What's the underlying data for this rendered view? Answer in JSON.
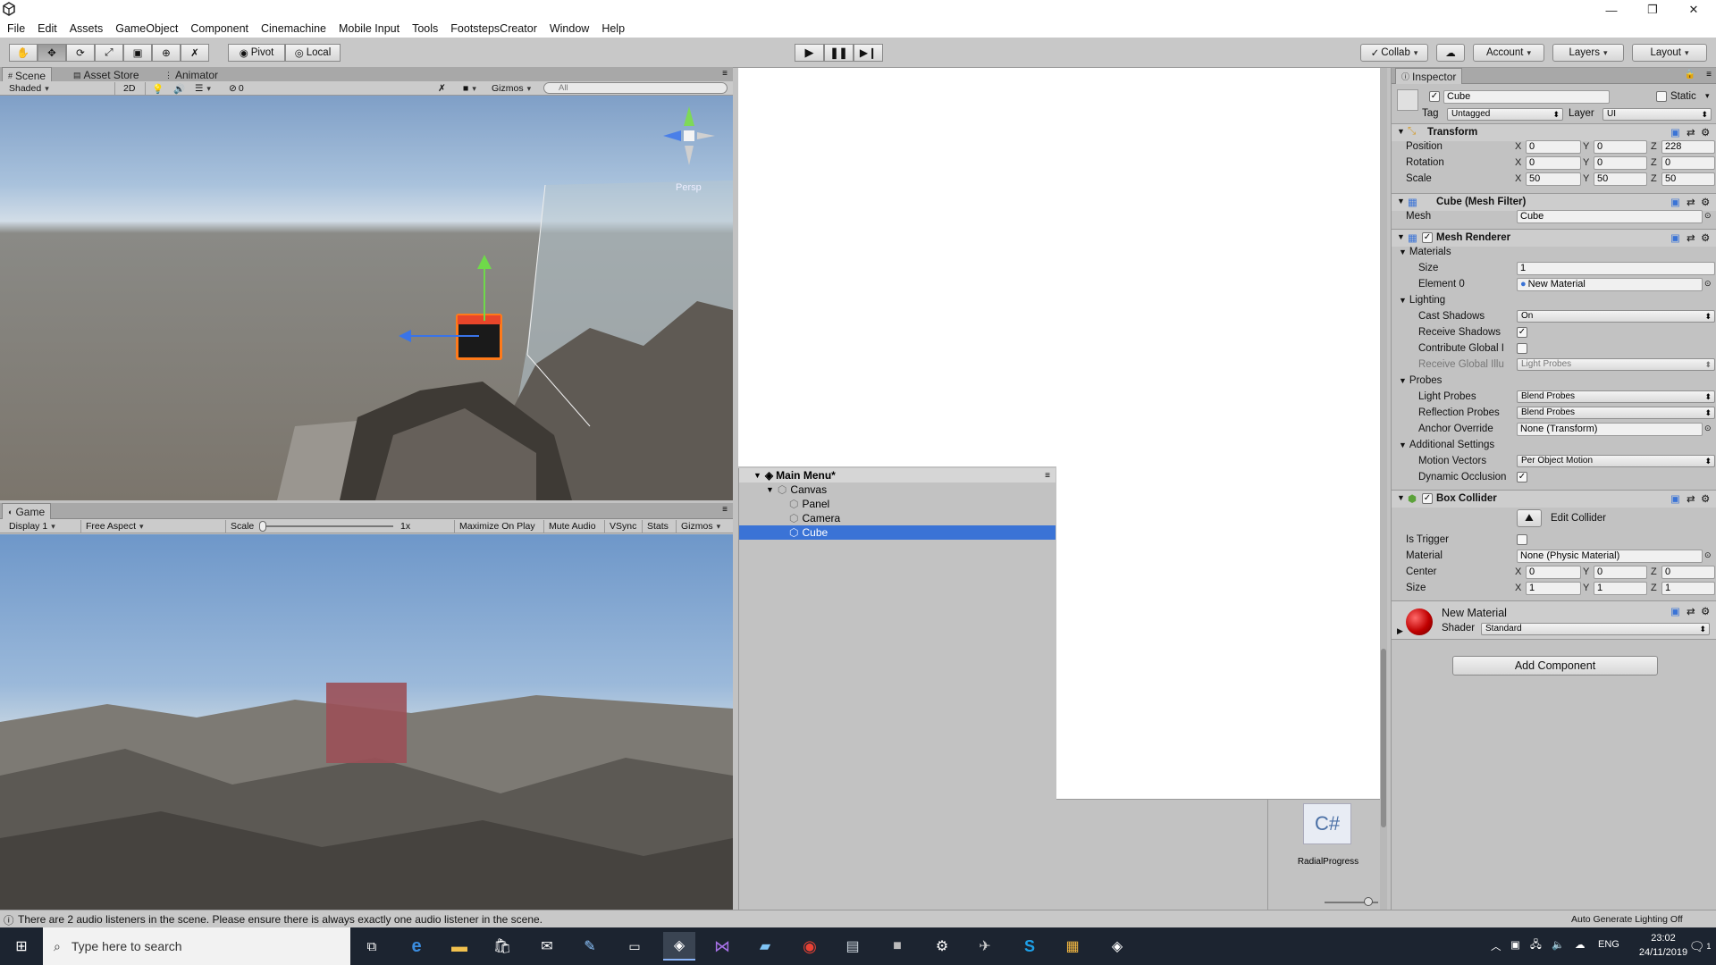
{
  "menu": [
    "File",
    "Edit",
    "Assets",
    "GameObject",
    "Component",
    "Cinemachine",
    "Mobile Input",
    "Tools",
    "FootstepsCreator",
    "Window",
    "Help"
  ],
  "toolbar": {
    "pivot": "Pivot",
    "local": "Local",
    "collab": "Collab",
    "account": "Account",
    "layers": "Layers",
    "layout": "Layout"
  },
  "scene": {
    "tabs": [
      "Scene",
      "Asset Store",
      "Animator"
    ],
    "shading": "Shaded",
    "mode2d": "2D",
    "fx_count": "0",
    "gizmos": "Gizmos",
    "search_placeholder": "All",
    "persp": "Persp"
  },
  "game": {
    "tab": "Game",
    "display": "Display 1",
    "aspect": "Free Aspect",
    "scale_label": "Scale",
    "scale_value": "1x",
    "maximize": "Maximize On Play",
    "mute": "Mute Audio",
    "vsync": "VSync",
    "stats": "Stats",
    "gizmos": "Gizmos"
  },
  "hierarchy": {
    "scene": "Main Menu*",
    "items": [
      "Canvas",
      "Panel",
      "Camera",
      "Cube"
    ]
  },
  "project": {
    "script_badge": "C#",
    "script_name": "RadialProgress"
  },
  "inspector": {
    "tab": "Inspector",
    "object_name": "Cube",
    "static": "Static",
    "tag_label": "Tag",
    "tag": "Untagged",
    "layer_label": "Layer",
    "layer": "UI",
    "transform": {
      "title": "Transform",
      "rows": [
        {
          "label": "Position",
          "x": "0",
          "y": "0",
          "z": "228"
        },
        {
          "label": "Rotation",
          "x": "0",
          "y": "0",
          "z": "0"
        },
        {
          "label": "Scale",
          "x": "50",
          "y": "50",
          "z": "50"
        }
      ]
    },
    "mesh_filter": {
      "title": "Cube (Mesh Filter)",
      "mesh_label": "Mesh",
      "mesh": "Cube"
    },
    "mesh_renderer": {
      "title": "Mesh Renderer",
      "materials": "Materials",
      "size_label": "Size",
      "size": "1",
      "element0_label": "Element 0",
      "element0": "New Material",
      "lighting": "Lighting",
      "cast_shadows_label": "Cast Shadows",
      "cast_shadows": "On",
      "receive_shadows": "Receive Shadows",
      "contribute_gi": "Contribute Global I",
      "receive_gi_label": "Receive Global Illu",
      "receive_gi": "Light Probes",
      "probes": "Probes",
      "light_probes_label": "Light Probes",
      "light_probes": "Blend Probes",
      "reflection_probes_label": "Reflection Probes",
      "reflection_probes": "Blend Probes",
      "anchor_label": "Anchor Override",
      "anchor": "None (Transform)",
      "additional": "Additional Settings",
      "motion_label": "Motion Vectors",
      "motion": "Per Object Motion",
      "dynamic_occlusion": "Dynamic Occlusion"
    },
    "box_collider": {
      "title": "Box Collider",
      "edit_collider": "Edit Collider",
      "is_trigger": "Is Trigger",
      "material_label": "Material",
      "material": "None (Physic Material)",
      "center_label": "Center",
      "center": {
        "x": "0",
        "y": "0",
        "z": "0"
      },
      "size_label": "Size",
      "size": {
        "x": "1",
        "y": "1",
        "z": "1"
      }
    },
    "material": {
      "name": "New Material",
      "shader_label": "Shader",
      "shader": "Standard"
    },
    "add_component": "Add Component"
  },
  "status": {
    "message": "There are 2 audio listeners in the scene. Please ensure there is always exactly one audio listener in the scene.",
    "lighting": "Auto Generate Lighting Off"
  },
  "taskbar": {
    "search_placeholder": "Type here to search",
    "lang": "ENG",
    "time": "23:02",
    "date": "24/11/2019",
    "notif": "1"
  },
  "colors": {
    "selection": "#3a73d6",
    "cube": "#e8462a",
    "taskbar": "#1c2430"
  }
}
